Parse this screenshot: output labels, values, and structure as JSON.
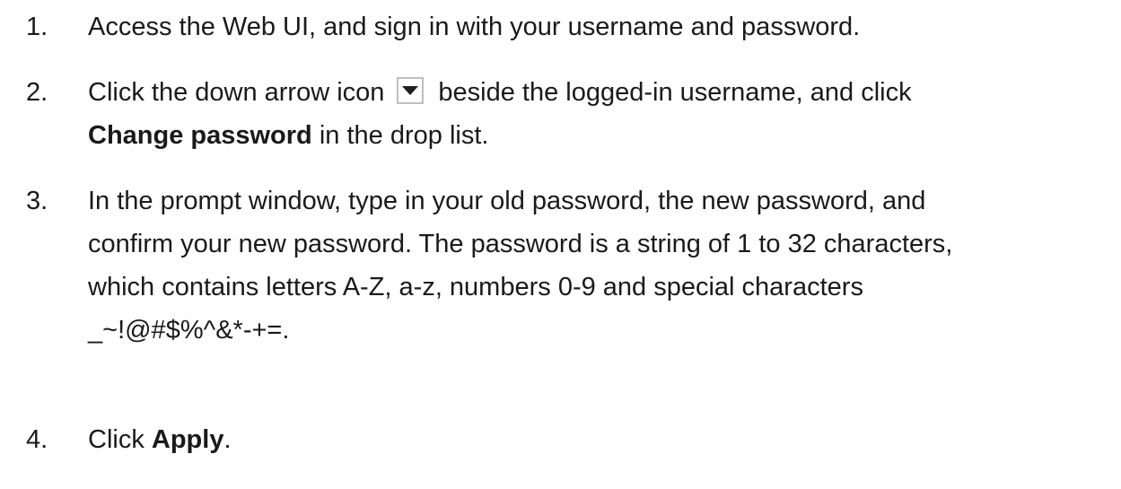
{
  "steps": [
    {
      "number": "1.",
      "text": "Access the Web UI, and sign in with your username and password."
    },
    {
      "number": "2.",
      "before_icon": "Click the down arrow icon",
      "icon": "down-arrow-icon",
      "after_icon": "beside the logged-in username, and click",
      "bold": "Change password",
      "after_bold": " in the drop list."
    },
    {
      "number": "3.",
      "lines": [
        "In the prompt window, type in your old password, the new password, and",
        "confirm your new password. The password is a string of 1 to 32 characters,",
        "which contains letters A-Z, a-z, numbers 0-9 and special characters",
        "_~!@#$%^&*-+=."
      ]
    },
    {
      "number": "4.",
      "before_bold": "Click ",
      "bold": "Apply",
      "after_bold": "."
    }
  ]
}
